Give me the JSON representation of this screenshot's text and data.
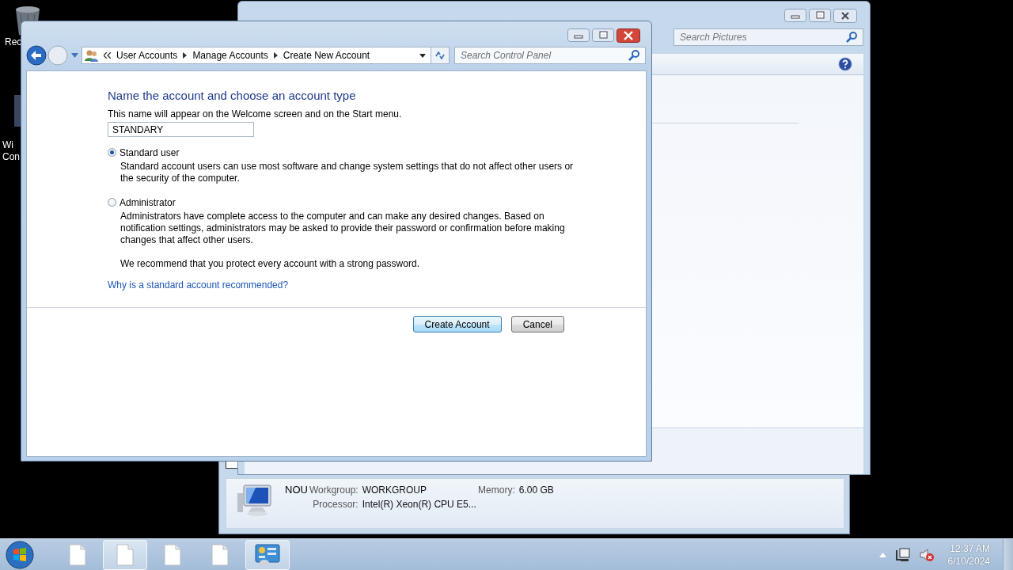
{
  "desktop_icons": [
    {
      "label": "Rec"
    },
    {
      "label": "Wi\nCon"
    }
  ],
  "pictures_window": {
    "search": {
      "placeholder": "Search Pictures"
    }
  },
  "details_window": {
    "computer_name": "NOU",
    "fields": [
      {
        "label": "Workgroup:",
        "value": "WORKGROUP"
      },
      {
        "label": "Memory:",
        "value": "6.00 GB"
      },
      {
        "label": "Processor:",
        "value": "Intel(R) Xeon(R) CPU E5..."
      }
    ]
  },
  "dialog": {
    "breadcrumb": [
      "User Accounts",
      "Manage Accounts",
      "Create New Account"
    ],
    "search": {
      "placeholder": "Search Control Panel"
    },
    "heading": "Name the account and choose an account type",
    "subtitle": "This name will appear on the Welcome screen and on the Start menu.",
    "name_field": {
      "value": "STANDARY"
    },
    "account_types": [
      {
        "label": "Standard user",
        "selected": true,
        "description": "Standard account users can use most software and change system settings that do not affect other users or the security of the computer."
      },
      {
        "label": "Administrator",
        "selected": false,
        "description": "Administrators have complete access to the computer and can make any desired changes. Based on notification settings, administrators may be asked to provide their password or confirmation before making changes that affect other users."
      }
    ],
    "recommendation": "We recommend that you protect every account with a strong password.",
    "help_link": "Why is a standard account recommended?",
    "buttons": [
      {
        "label": "Create Account",
        "default": true
      },
      {
        "label": "Cancel",
        "default": false
      }
    ]
  },
  "taskbar": {
    "items": [
      {
        "kind": "document",
        "active": false
      },
      {
        "kind": "document",
        "active": true
      },
      {
        "kind": "document",
        "active": false
      },
      {
        "kind": "document",
        "active": false
      },
      {
        "kind": "control-panel",
        "active": true
      }
    ],
    "volume": {
      "muted": true
    },
    "clock": {
      "time": "12:37 AM",
      "date": "6/10/2024"
    }
  }
}
